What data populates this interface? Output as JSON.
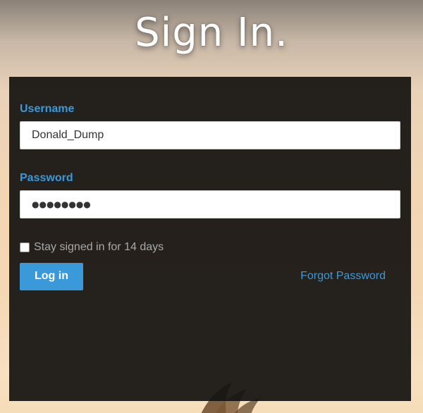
{
  "page": {
    "title": "Sign In."
  },
  "form": {
    "username_label": "Username",
    "username_value": "Donald_Dump",
    "password_label": "Password",
    "password_masked": "●●●●●●●●",
    "remember_label": "Stay signed in for 14 days",
    "remember_checked": false,
    "login_label": "Log in",
    "forgot_label": "Forgot Password"
  },
  "colors": {
    "accent": "#3a9ad9",
    "panel": "#141210",
    "muted_text": "#a9a9a9"
  }
}
